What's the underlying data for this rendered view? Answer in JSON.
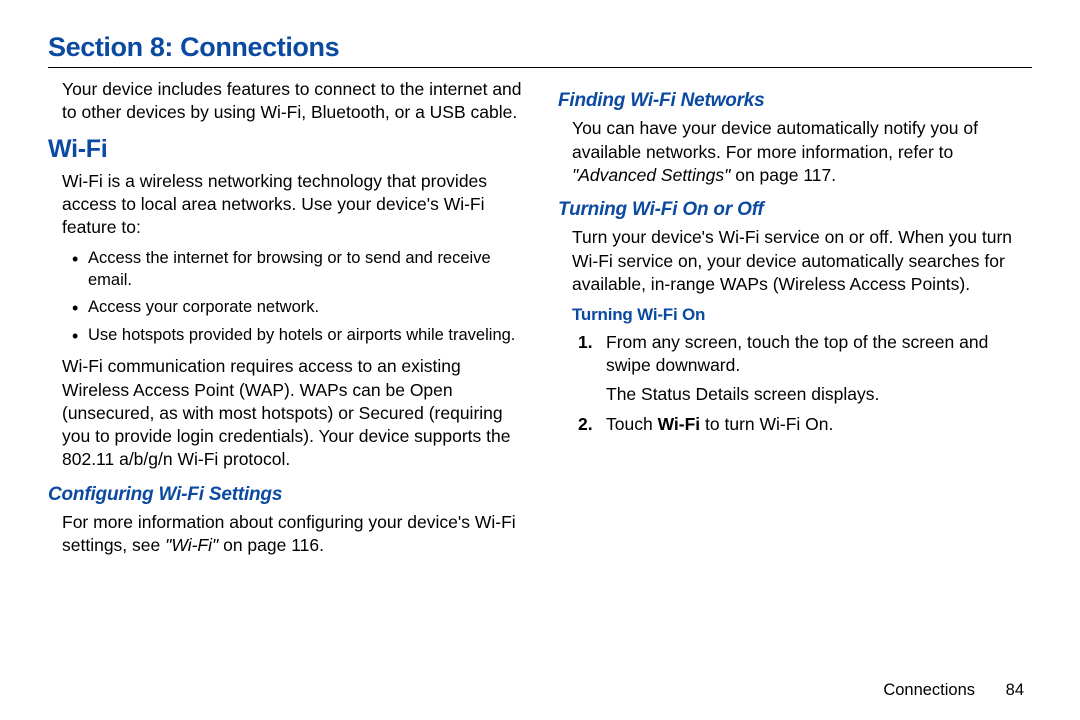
{
  "section_title": "Section 8: Connections",
  "intro": "Your device includes features to connect to the internet and to other devices by using Wi-Fi, Bluetooth, or a USB cable.",
  "wifi": {
    "heading": "Wi-Fi",
    "desc": "Wi-Fi is a wireless networking technology that provides access to local area networks. Use your device's Wi-Fi feature to:",
    "bullets": [
      "Access the internet for browsing or to send and receive email.",
      "Access your corporate network.",
      "Use hotspots provided by hotels or airports while traveling."
    ],
    "note": "Wi-Fi communication requires access to an existing Wireless Access Point (WAP). WAPs can be Open (unsecured, as with most hotspots) or Secured (requiring you to provide login credentials). Your device supports the 802.11 a/b/g/n Wi-Fi protocol.",
    "config": {
      "heading": "Configuring Wi-Fi Settings",
      "prefix": "For more information about configuring your device's Wi-Fi settings, see ",
      "ref": "\"Wi-Fi\"",
      "suffix": " on page 116."
    }
  },
  "right": {
    "finding": {
      "heading": "Finding Wi-Fi Networks",
      "prefix": "You can have your device automatically notify you of available networks. For more information, refer to ",
      "ref": "\"Advanced Settings\"",
      "suffix": " on page 117."
    },
    "onoff": {
      "heading": "Turning Wi-Fi On or Off",
      "body": "Turn your device's Wi-Fi service on or off. When you turn Wi-Fi service on, your device automatically searches for available, in-range WAPs (Wireless Access Points)."
    },
    "turnon": {
      "heading": "Turning Wi-Fi On",
      "step1_num": "1.",
      "step1": "From any screen, touch the top of the screen and swipe downward.",
      "step1_sub": "The Status Details screen displays.",
      "step2_num": "2.",
      "step2_pre": "Touch ",
      "step2_bold": "Wi-Fi",
      "step2_post": " to turn Wi-Fi On."
    }
  },
  "footer": {
    "label": "Connections",
    "page": "84"
  }
}
